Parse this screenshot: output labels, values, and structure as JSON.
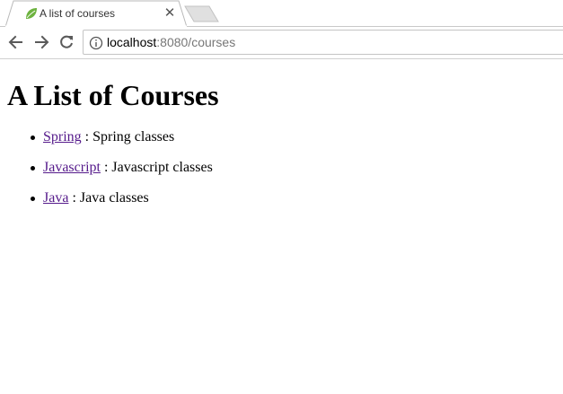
{
  "browser": {
    "tab": {
      "title": "A list of courses",
      "favicon": "spring-leaf-icon",
      "close_glyph": "✕"
    },
    "address_bar": {
      "host": "localhost",
      "rest": ":8080/courses"
    },
    "icons": {
      "back": "back-arrow-icon",
      "forward": "forward-arrow-icon",
      "reload": "reload-icon",
      "info": "info-icon"
    }
  },
  "page": {
    "heading": "A List of Courses",
    "courses": [
      {
        "name": "Spring",
        "description": " : Spring classes"
      },
      {
        "name": "Javascript",
        "description": " : Javascript classes"
      },
      {
        "name": "Java",
        "description": " : Java classes"
      }
    ]
  },
  "colors": {
    "visited_link": "#551a8b",
    "favicon_green": "#6db33f"
  }
}
